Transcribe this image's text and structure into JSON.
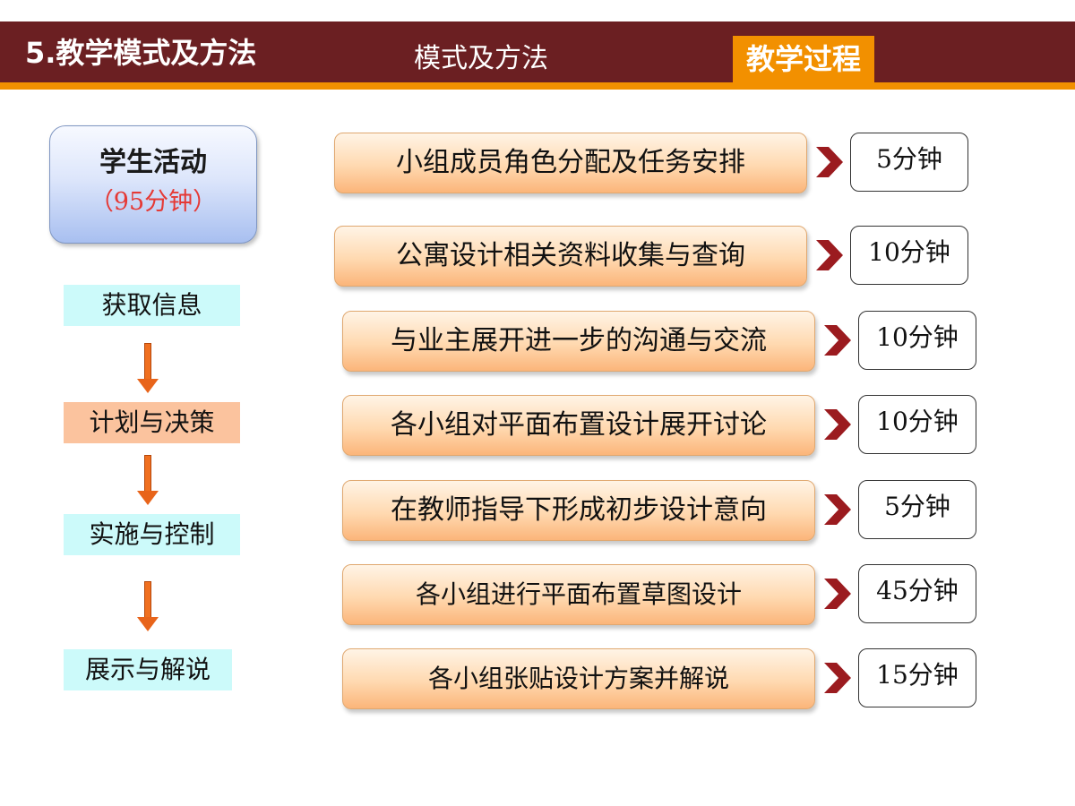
{
  "header": {
    "section_title": "5.教学模式及方法",
    "tab_mode": "模式及方法",
    "tab_process": "教学过程"
  },
  "colors": {
    "header_bg": "#6b1f22",
    "accent_orange": "#f29000",
    "duration_red": "#e53935",
    "chevron": "#9b1b1f"
  },
  "student_activity": {
    "title": "学生活动",
    "duration": "（95分钟）"
  },
  "steps": [
    "获取信息",
    "计划与决策",
    "实施与控制",
    "展示与解说"
  ],
  "tasks": [
    {
      "label": "小组成员角色分配及任务安排",
      "time": "5分钟"
    },
    {
      "label": "公寓设计相关资料收集与查询",
      "time": "10分钟"
    },
    {
      "label": "与业主展开进一步的沟通与交流",
      "time": "10分钟"
    },
    {
      "label": "各小组对平面布置设计展开讨论",
      "time": "10分钟"
    },
    {
      "label": "在教师指导下形成初步设计意向",
      "time": "5分钟"
    },
    {
      "label": "各小组进行平面布置草图设计",
      "time": "45分钟"
    },
    {
      "label": "各小组张贴设计方案并解说",
      "time": "15分钟"
    }
  ]
}
